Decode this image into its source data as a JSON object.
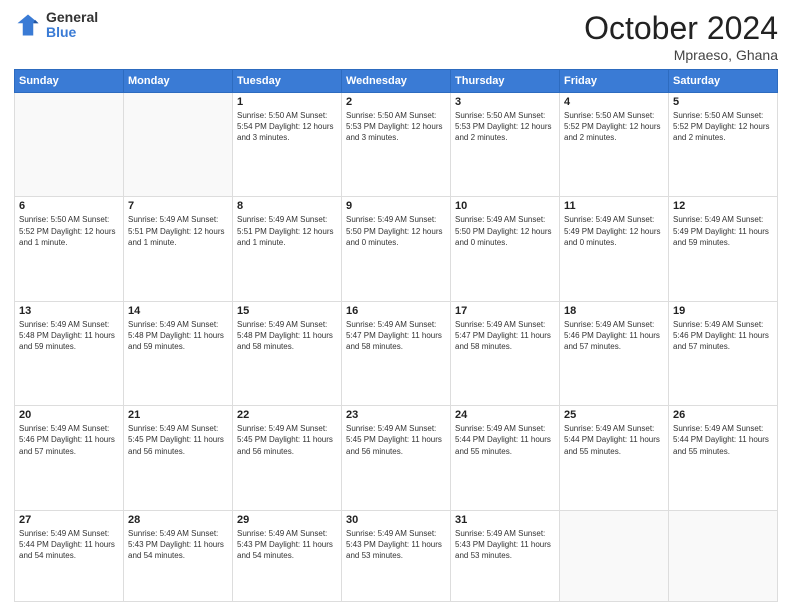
{
  "header": {
    "logo_general": "General",
    "logo_blue": "Blue",
    "title": "October 2024",
    "location": "Mpraeso, Ghana"
  },
  "weekdays": [
    "Sunday",
    "Monday",
    "Tuesday",
    "Wednesday",
    "Thursday",
    "Friday",
    "Saturday"
  ],
  "weeks": [
    [
      {
        "day": "",
        "detail": ""
      },
      {
        "day": "",
        "detail": ""
      },
      {
        "day": "1",
        "detail": "Sunrise: 5:50 AM\nSunset: 5:54 PM\nDaylight: 12 hours\nand 3 minutes."
      },
      {
        "day": "2",
        "detail": "Sunrise: 5:50 AM\nSunset: 5:53 PM\nDaylight: 12 hours\nand 3 minutes."
      },
      {
        "day": "3",
        "detail": "Sunrise: 5:50 AM\nSunset: 5:53 PM\nDaylight: 12 hours\nand 2 minutes."
      },
      {
        "day": "4",
        "detail": "Sunrise: 5:50 AM\nSunset: 5:52 PM\nDaylight: 12 hours\nand 2 minutes."
      },
      {
        "day": "5",
        "detail": "Sunrise: 5:50 AM\nSunset: 5:52 PM\nDaylight: 12 hours\nand 2 minutes."
      }
    ],
    [
      {
        "day": "6",
        "detail": "Sunrise: 5:50 AM\nSunset: 5:52 PM\nDaylight: 12 hours\nand 1 minute."
      },
      {
        "day": "7",
        "detail": "Sunrise: 5:49 AM\nSunset: 5:51 PM\nDaylight: 12 hours\nand 1 minute."
      },
      {
        "day": "8",
        "detail": "Sunrise: 5:49 AM\nSunset: 5:51 PM\nDaylight: 12 hours\nand 1 minute."
      },
      {
        "day": "9",
        "detail": "Sunrise: 5:49 AM\nSunset: 5:50 PM\nDaylight: 12 hours\nand 0 minutes."
      },
      {
        "day": "10",
        "detail": "Sunrise: 5:49 AM\nSunset: 5:50 PM\nDaylight: 12 hours\nand 0 minutes."
      },
      {
        "day": "11",
        "detail": "Sunrise: 5:49 AM\nSunset: 5:49 PM\nDaylight: 12 hours\nand 0 minutes."
      },
      {
        "day": "12",
        "detail": "Sunrise: 5:49 AM\nSunset: 5:49 PM\nDaylight: 11 hours\nand 59 minutes."
      }
    ],
    [
      {
        "day": "13",
        "detail": "Sunrise: 5:49 AM\nSunset: 5:48 PM\nDaylight: 11 hours\nand 59 minutes."
      },
      {
        "day": "14",
        "detail": "Sunrise: 5:49 AM\nSunset: 5:48 PM\nDaylight: 11 hours\nand 59 minutes."
      },
      {
        "day": "15",
        "detail": "Sunrise: 5:49 AM\nSunset: 5:48 PM\nDaylight: 11 hours\nand 58 minutes."
      },
      {
        "day": "16",
        "detail": "Sunrise: 5:49 AM\nSunset: 5:47 PM\nDaylight: 11 hours\nand 58 minutes."
      },
      {
        "day": "17",
        "detail": "Sunrise: 5:49 AM\nSunset: 5:47 PM\nDaylight: 11 hours\nand 58 minutes."
      },
      {
        "day": "18",
        "detail": "Sunrise: 5:49 AM\nSunset: 5:46 PM\nDaylight: 11 hours\nand 57 minutes."
      },
      {
        "day": "19",
        "detail": "Sunrise: 5:49 AM\nSunset: 5:46 PM\nDaylight: 11 hours\nand 57 minutes."
      }
    ],
    [
      {
        "day": "20",
        "detail": "Sunrise: 5:49 AM\nSunset: 5:46 PM\nDaylight: 11 hours\nand 57 minutes."
      },
      {
        "day": "21",
        "detail": "Sunrise: 5:49 AM\nSunset: 5:45 PM\nDaylight: 11 hours\nand 56 minutes."
      },
      {
        "day": "22",
        "detail": "Sunrise: 5:49 AM\nSunset: 5:45 PM\nDaylight: 11 hours\nand 56 minutes."
      },
      {
        "day": "23",
        "detail": "Sunrise: 5:49 AM\nSunset: 5:45 PM\nDaylight: 11 hours\nand 56 minutes."
      },
      {
        "day": "24",
        "detail": "Sunrise: 5:49 AM\nSunset: 5:44 PM\nDaylight: 11 hours\nand 55 minutes."
      },
      {
        "day": "25",
        "detail": "Sunrise: 5:49 AM\nSunset: 5:44 PM\nDaylight: 11 hours\nand 55 minutes."
      },
      {
        "day": "26",
        "detail": "Sunrise: 5:49 AM\nSunset: 5:44 PM\nDaylight: 11 hours\nand 55 minutes."
      }
    ],
    [
      {
        "day": "27",
        "detail": "Sunrise: 5:49 AM\nSunset: 5:44 PM\nDaylight: 11 hours\nand 54 minutes."
      },
      {
        "day": "28",
        "detail": "Sunrise: 5:49 AM\nSunset: 5:43 PM\nDaylight: 11 hours\nand 54 minutes."
      },
      {
        "day": "29",
        "detail": "Sunrise: 5:49 AM\nSunset: 5:43 PM\nDaylight: 11 hours\nand 54 minutes."
      },
      {
        "day": "30",
        "detail": "Sunrise: 5:49 AM\nSunset: 5:43 PM\nDaylight: 11 hours\nand 53 minutes."
      },
      {
        "day": "31",
        "detail": "Sunrise: 5:49 AM\nSunset: 5:43 PM\nDaylight: 11 hours\nand 53 minutes."
      },
      {
        "day": "",
        "detail": ""
      },
      {
        "day": "",
        "detail": ""
      }
    ]
  ]
}
